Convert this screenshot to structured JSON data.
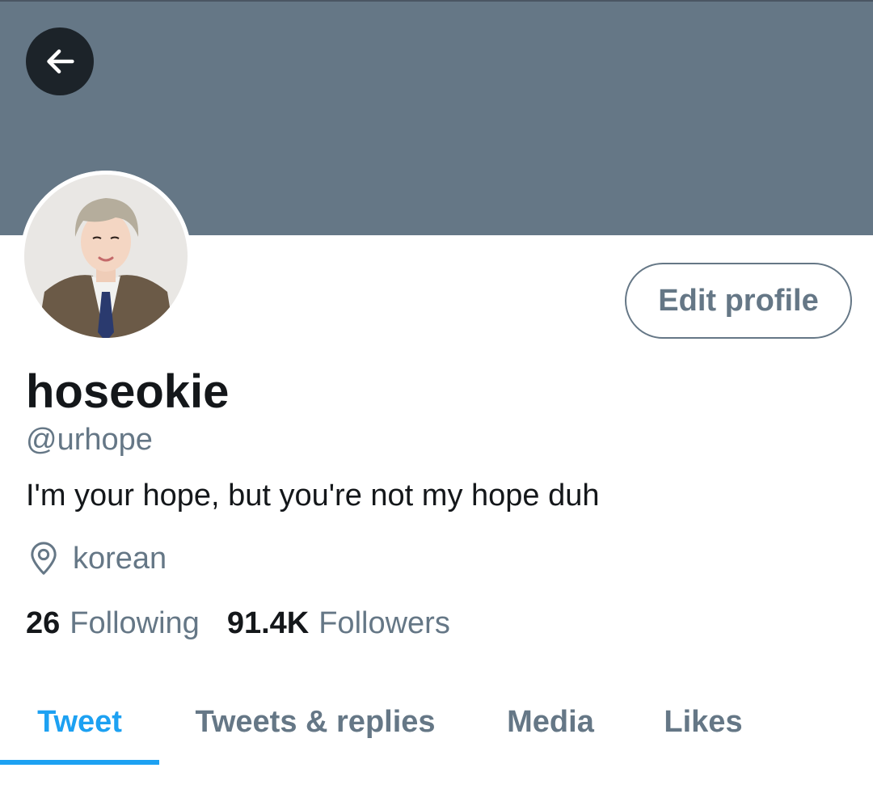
{
  "profile": {
    "display_name": "hoseokie",
    "handle": "@urhope",
    "bio": "I'm your hope, but you're not my hope duh",
    "location": "korean",
    "edit_button": "Edit profile"
  },
  "stats": {
    "following_count": "26",
    "following_label": "Following",
    "followers_count": "91.4K",
    "followers_label": "Followers"
  },
  "tabs": [
    {
      "label": "Tweet",
      "active": true
    },
    {
      "label": "Tweets & replies",
      "active": false
    },
    {
      "label": "Media",
      "active": false
    },
    {
      "label": "Likes",
      "active": false
    }
  ],
  "icons": {
    "back": "arrow-left-icon",
    "location": "location-pin-icon"
  },
  "colors": {
    "banner": "#657786",
    "accent": "#1da1f2",
    "secondary_text": "#657786",
    "primary_text": "#14171a"
  }
}
